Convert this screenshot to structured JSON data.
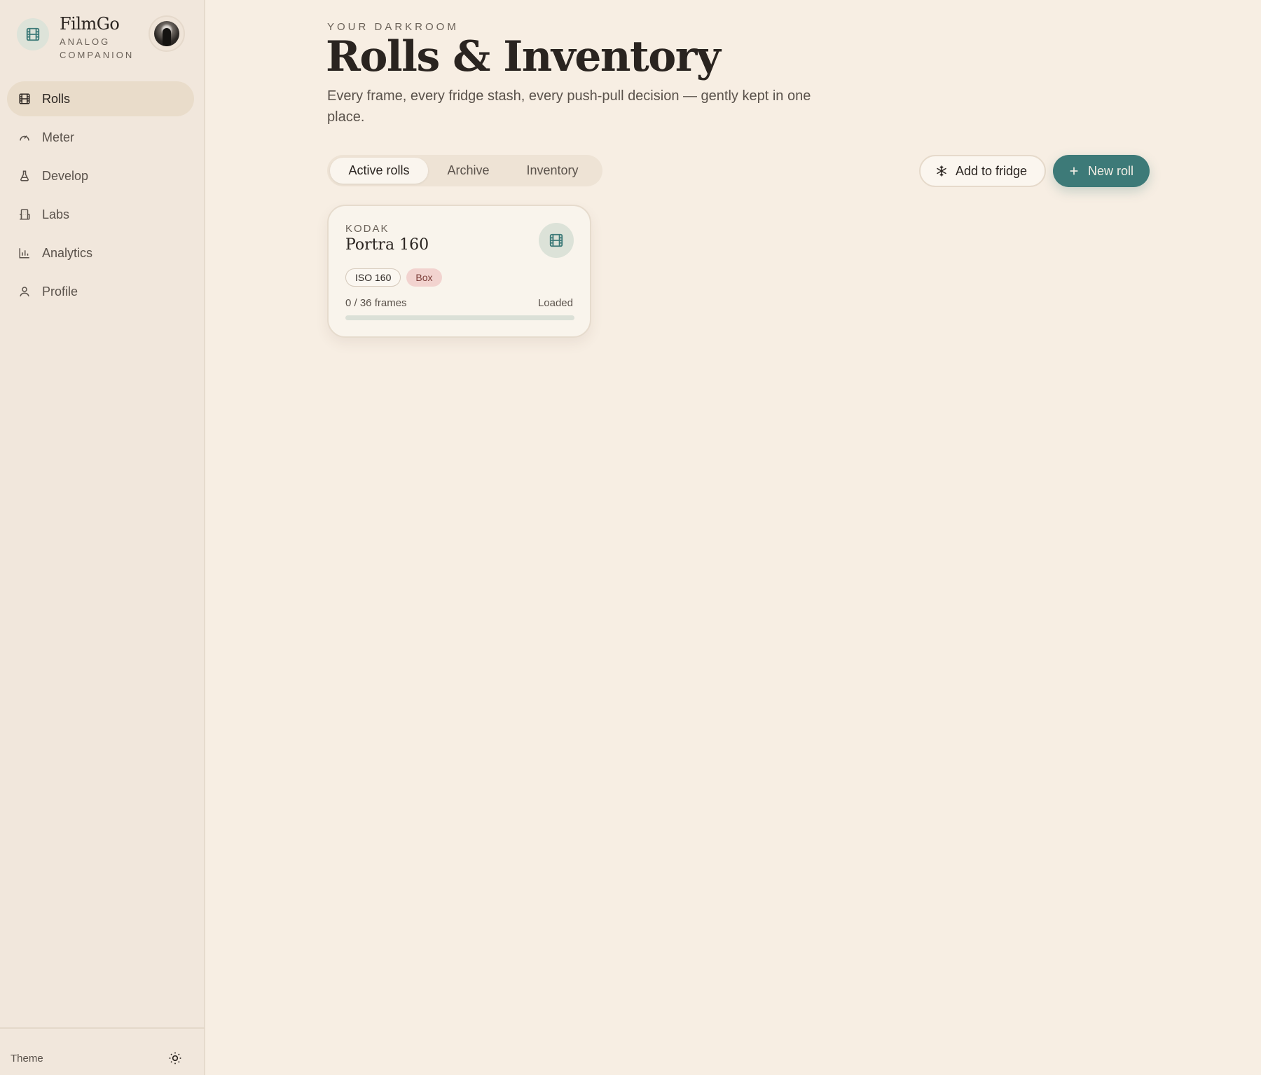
{
  "brand": {
    "name": "FilmGo",
    "subtitle": "ANALOG COMPANION",
    "accent": "#3d7a78"
  },
  "sidebar": {
    "items": [
      {
        "label": "Rolls",
        "icon": "film-icon",
        "active": true
      },
      {
        "label": "Meter",
        "icon": "gauge-icon",
        "active": false
      },
      {
        "label": "Develop",
        "icon": "flask-icon",
        "active": false
      },
      {
        "label": "Labs",
        "icon": "building-icon",
        "active": false
      },
      {
        "label": "Analytics",
        "icon": "bar-chart-icon",
        "active": false
      },
      {
        "label": "Profile",
        "icon": "user-icon",
        "active": false
      }
    ],
    "footer": {
      "theme_label": "Theme",
      "theme_icon": "sun-icon"
    }
  },
  "header": {
    "eyebrow": "YOUR DARKROOM",
    "title": "Rolls & Inventory",
    "subtitle": "Every frame, every fridge stash, every push-pull decision — gently kept in one place."
  },
  "tabs": [
    {
      "label": "Active rolls",
      "active": true
    },
    {
      "label": "Archive",
      "active": false
    },
    {
      "label": "Inventory",
      "active": false
    }
  ],
  "actions": {
    "add_fridge": {
      "label": "Add to fridge",
      "icon": "snowflake-icon"
    },
    "new_roll": {
      "label": "New roll",
      "icon": "plus-icon"
    }
  },
  "rolls": [
    {
      "brand": "KODAK",
      "name": "Portra 160",
      "iso": "ISO 160",
      "format_tag": "Box",
      "frames": "0 / 36 frames",
      "status": "Loaded",
      "progress": 0
    }
  ],
  "colors": {
    "background": "#f7eee3",
    "sidebar": "#f1e7dc",
    "primary": "#3d7a78",
    "tag_pink": "#f2d3cf"
  }
}
